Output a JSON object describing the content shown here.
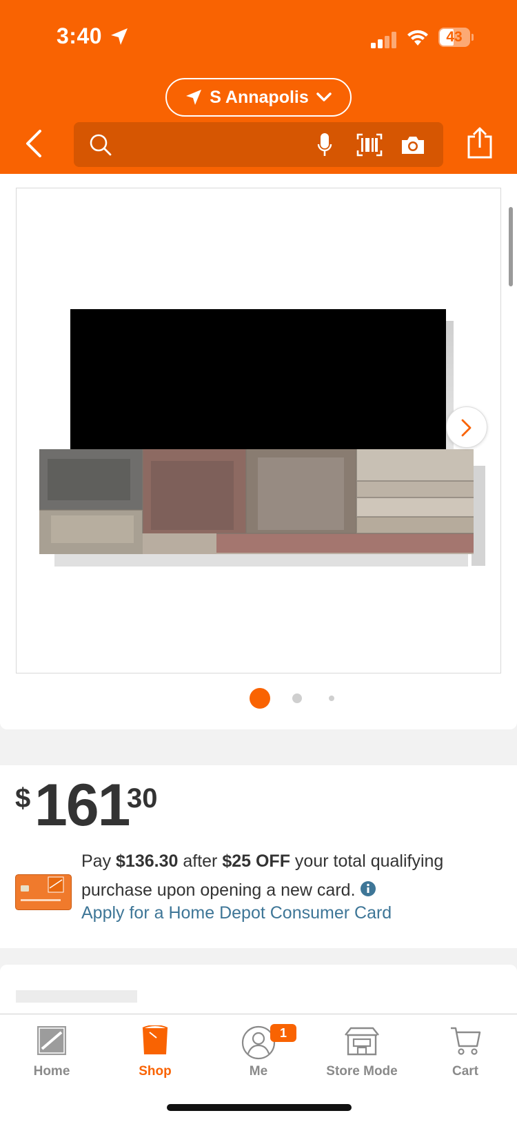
{
  "status_bar": {
    "time": "3:40",
    "battery": "43"
  },
  "header": {
    "store_name": "S Annapolis",
    "search_placeholder": ""
  },
  "gallery": {
    "total_dots": 3,
    "active_index": 0
  },
  "price": {
    "currency": "$",
    "dollars": "161",
    "cents": "30"
  },
  "promo": {
    "pay_prefix": "Pay ",
    "pay_amount": "$136.30",
    "after_text": " after ",
    "discount": "$25 OFF",
    "rest_text": " your total qualifying purchase upon opening a new card.",
    "link": "Apply for a Home Depot Consumer Card"
  },
  "tabs": [
    {
      "label": "Home",
      "icon": "home-depot-logo-icon"
    },
    {
      "label": "Shop",
      "icon": "shop-bucket-icon"
    },
    {
      "label": "Me",
      "icon": "person-icon"
    },
    {
      "label": "Store Mode",
      "icon": "store-icon"
    },
    {
      "label": "Cart",
      "icon": "cart-icon"
    }
  ],
  "me_badge": "1",
  "colors": {
    "brand_orange": "#f96302",
    "link_blue": "#3e7697"
  }
}
